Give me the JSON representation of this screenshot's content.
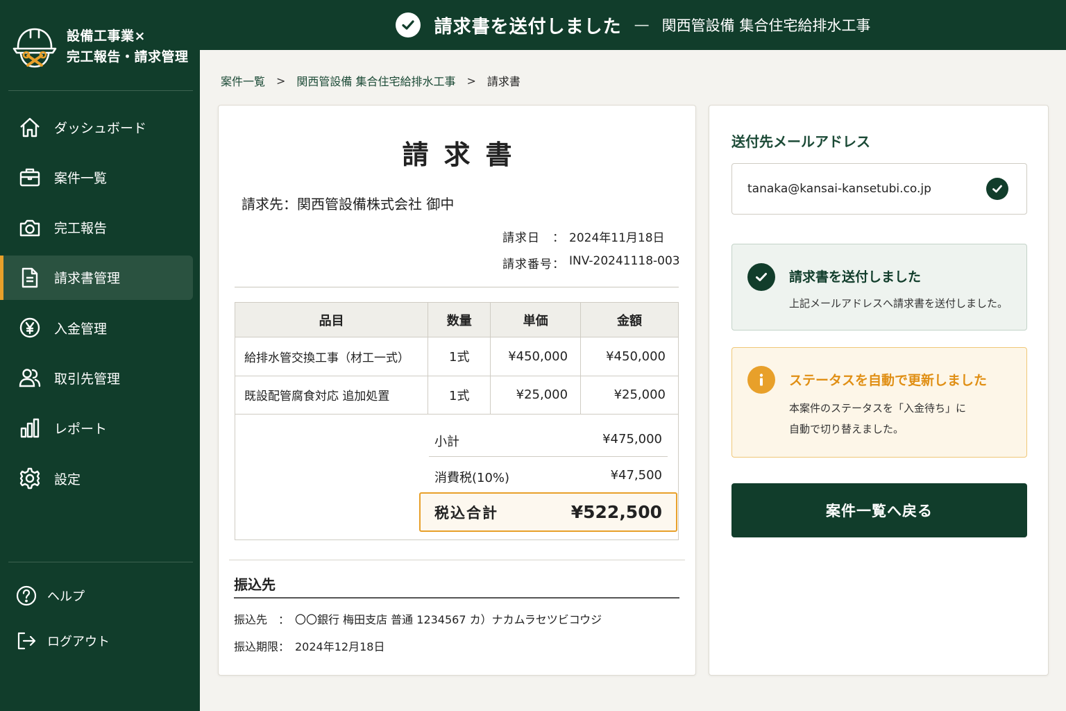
{
  "app": {
    "title_line1": "設備工事業×",
    "title_line2": "完工報告・請求管理"
  },
  "sidebar": {
    "items": [
      {
        "label": "ダッシュボード",
        "icon": "home-icon"
      },
      {
        "label": "案件一覧",
        "icon": "briefcase-icon"
      },
      {
        "label": "完工報告",
        "icon": "camera-icon"
      },
      {
        "label": "請求書管理",
        "icon": "document-icon",
        "active": true
      },
      {
        "label": "入金管理",
        "icon": "yen-icon"
      },
      {
        "label": "取引先管理",
        "icon": "users-icon"
      },
      {
        "label": "レポート",
        "icon": "bar-chart-icon"
      },
      {
        "label": "設定",
        "icon": "gear-icon"
      }
    ],
    "bottom": [
      {
        "label": "ヘルプ",
        "icon": "help-icon"
      },
      {
        "label": "ログアウト",
        "icon": "logout-icon"
      }
    ]
  },
  "banner": {
    "title": "請求書を送付しました",
    "dash": "—",
    "project": "関西管設備 集合住宅給排水工事"
  },
  "breadcrumb": {
    "items": [
      "案件一覧",
      "関西管設備 集合住宅給排水工事",
      "請求書"
    ],
    "separator": ">"
  },
  "invoice": {
    "title": "請求書",
    "recipient": "請求先：関西管設備株式会社 御中",
    "date_label": "請求日　：",
    "date": "2024年11月18日",
    "number_label": "請求番号：",
    "number": "INV-20241118-003",
    "columns": [
      "品目",
      "数量",
      "単価",
      "金額"
    ],
    "rows": [
      [
        "給排水管交換工事（材工一式）",
        "1式",
        "¥450,000",
        "¥450,000"
      ],
      [
        "既設配管腐食対応 追加処置",
        "1式",
        "¥25,000",
        "¥25,000"
      ]
    ],
    "subtotal_label": "小計",
    "subtotal": "¥475,000",
    "tax_label": "消費税(10%)",
    "tax": "¥47,500",
    "total_label": "税込合計",
    "total": "¥522,500",
    "payment": {
      "title": "振込先",
      "account_label": "振込先　：",
      "account": "〇〇銀行 梅田支店 普通 1234567 カ）ナカムラセツビコウジ",
      "deadline_label": "振込期限：",
      "deadline": "2024年12月18日"
    }
  },
  "panel": {
    "email_label": "送付先メールアドレス",
    "email": "tanaka@kansai-kansetubi.co.jp",
    "success_title": "請求書を送付しました",
    "success_desc": "上記メールアドレスへ請求書を送付しました。",
    "warn_title": "ステータスを自動で更新しました",
    "warn_desc_line1": "本案件のステータスを「入金待ち」に",
    "warn_desc_line2": "自動で切り替えました。",
    "back_button": "案件一覧へ戻る"
  },
  "colors": {
    "primary": "#113d2b",
    "accent": "#e8a02a",
    "background": "#f4f3ef"
  }
}
